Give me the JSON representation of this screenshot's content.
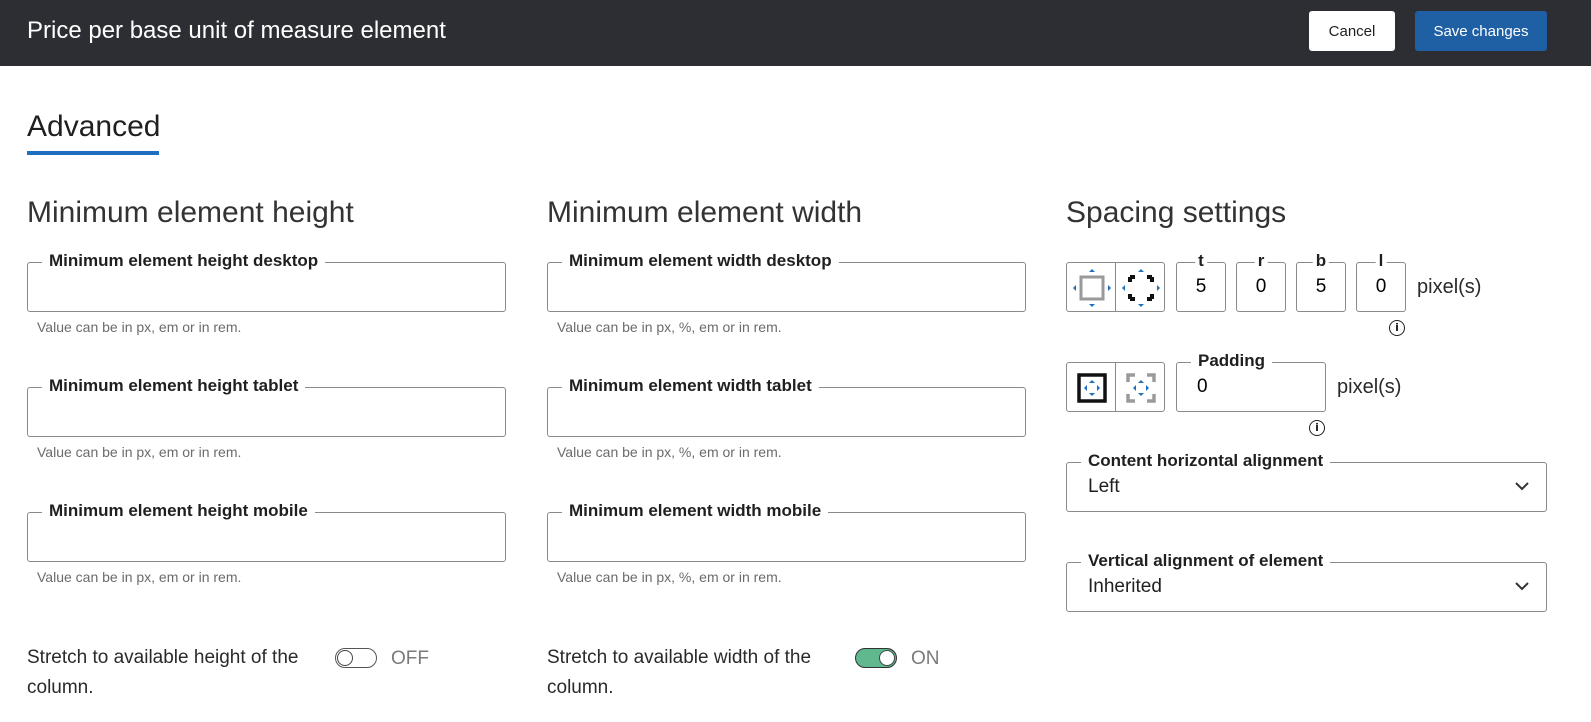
{
  "header": {
    "title": "Price per base unit of measure element",
    "cancel_label": "Cancel",
    "save_label": "Save changes"
  },
  "tab": {
    "label": "Advanced"
  },
  "height_section": {
    "title": "Minimum element height",
    "fields": [
      {
        "label": "Minimum element height desktop",
        "value": "",
        "hint": "Value can be in px, em or in rem."
      },
      {
        "label": "Minimum element height tablet",
        "value": "",
        "hint": "Value can be in px, em or in rem."
      },
      {
        "label": "Minimum element height mobile",
        "value": "",
        "hint": "Value can be in px, em or in rem."
      }
    ],
    "stretch_label": "Stretch to available height of the column.",
    "stretch_state": "OFF"
  },
  "width_section": {
    "title": "Minimum element width",
    "fields": [
      {
        "label": "Minimum element width desktop",
        "value": "",
        "hint": "Value can be in px, %, em or in rem."
      },
      {
        "label": "Minimum element width tablet",
        "value": "",
        "hint": "Value can be in px, %, em or in rem."
      },
      {
        "label": "Minimum element width mobile",
        "value": "",
        "hint": "Value can be in px, %, em or in rem."
      }
    ],
    "stretch_label": "Stretch to available width of the column.",
    "stretch_state": "ON"
  },
  "spacing_section": {
    "title": "Spacing settings",
    "margin": {
      "t_label": "t",
      "t_value": "5",
      "r_label": "r",
      "r_value": "0",
      "b_label": "b",
      "b_value": "5",
      "l_label": "l",
      "l_value": "0",
      "unit": "pixel(s)",
      "info_icon": "info-icon"
    },
    "padding": {
      "label": "Padding",
      "value": "0",
      "unit": "pixel(s)",
      "info_icon": "info-icon"
    },
    "horizontal_alignment": {
      "label": "Content horizontal alignment",
      "value": "Left"
    },
    "vertical_alignment": {
      "label": "Vertical alignment of element",
      "value": "Inherited"
    }
  },
  "colors": {
    "header_bg": "#2d2e33",
    "primary": "#1f5fa3",
    "tab_underline": "#1f6fc0",
    "toggle_on": "#5fb88e"
  }
}
